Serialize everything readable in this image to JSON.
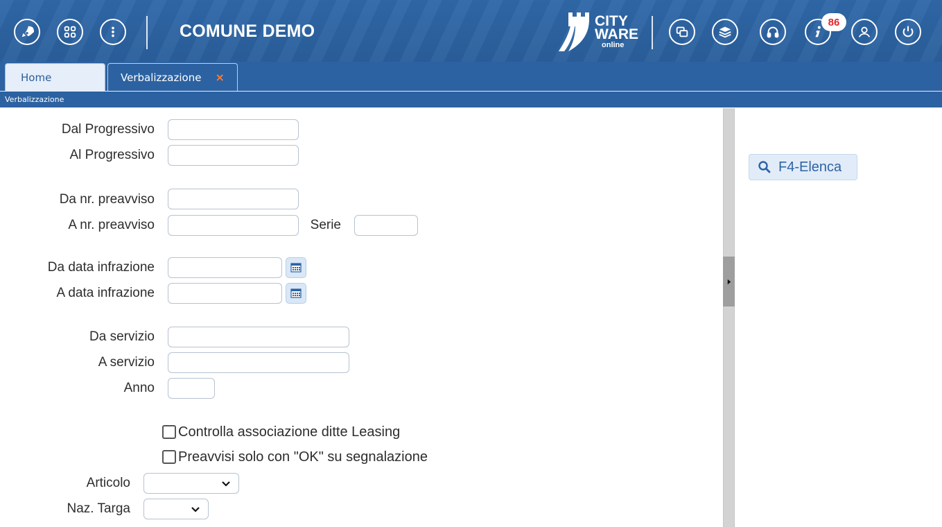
{
  "header": {
    "title": "COMUNE DEMO",
    "logo": {
      "line1": "CITY",
      "line2": "WARE",
      "line3": "online"
    },
    "notification_count": "86",
    "left_icons": [
      "rocket-icon",
      "apps-grid-icon",
      "more-vertical-icon"
    ],
    "right_icons": [
      "windows-icon",
      "stack-icon",
      "headset-icon",
      "info-icon",
      "user-icon",
      "power-icon"
    ]
  },
  "tabs": [
    {
      "label": "Home"
    },
    {
      "label": "Verbalizzazione",
      "close": "×"
    }
  ],
  "breadcrumb": "Verbalizzazione",
  "form": {
    "dal_progressivo": {
      "label": "Dal Progressivo",
      "value": ""
    },
    "al_progressivo": {
      "label": "Al Progressivo",
      "value": ""
    },
    "da_nr_preavviso": {
      "label": "Da nr. preavviso",
      "value": ""
    },
    "a_nr_preavviso": {
      "label": "A nr. preavviso",
      "value": ""
    },
    "serie": {
      "label": "Serie",
      "value": ""
    },
    "da_data_infrazione": {
      "label": "Da data infrazione",
      "value": ""
    },
    "a_data_infrazione": {
      "label": "A data infrazione",
      "value": ""
    },
    "da_servizio": {
      "label": "Da servizio",
      "value": ""
    },
    "a_servizio": {
      "label": "A servizio",
      "value": ""
    },
    "anno": {
      "label": "Anno",
      "value": ""
    },
    "chk_leasing": {
      "label": "Controlla associazione ditte Leasing",
      "checked": false
    },
    "chk_ok": {
      "label": "Preavvisi solo con \"OK\" su segnalazione",
      "checked": false
    },
    "articolo": {
      "label": "Articolo",
      "value": ""
    },
    "naz_targa": {
      "label": "Naz. Targa",
      "value": ""
    }
  },
  "side_panel": {
    "elenca_label": "F4-Elenca"
  },
  "colors": {
    "header_blue": "#2c62a1",
    "accent_orange": "#ff7b2e",
    "badge_red": "#e3262b"
  }
}
